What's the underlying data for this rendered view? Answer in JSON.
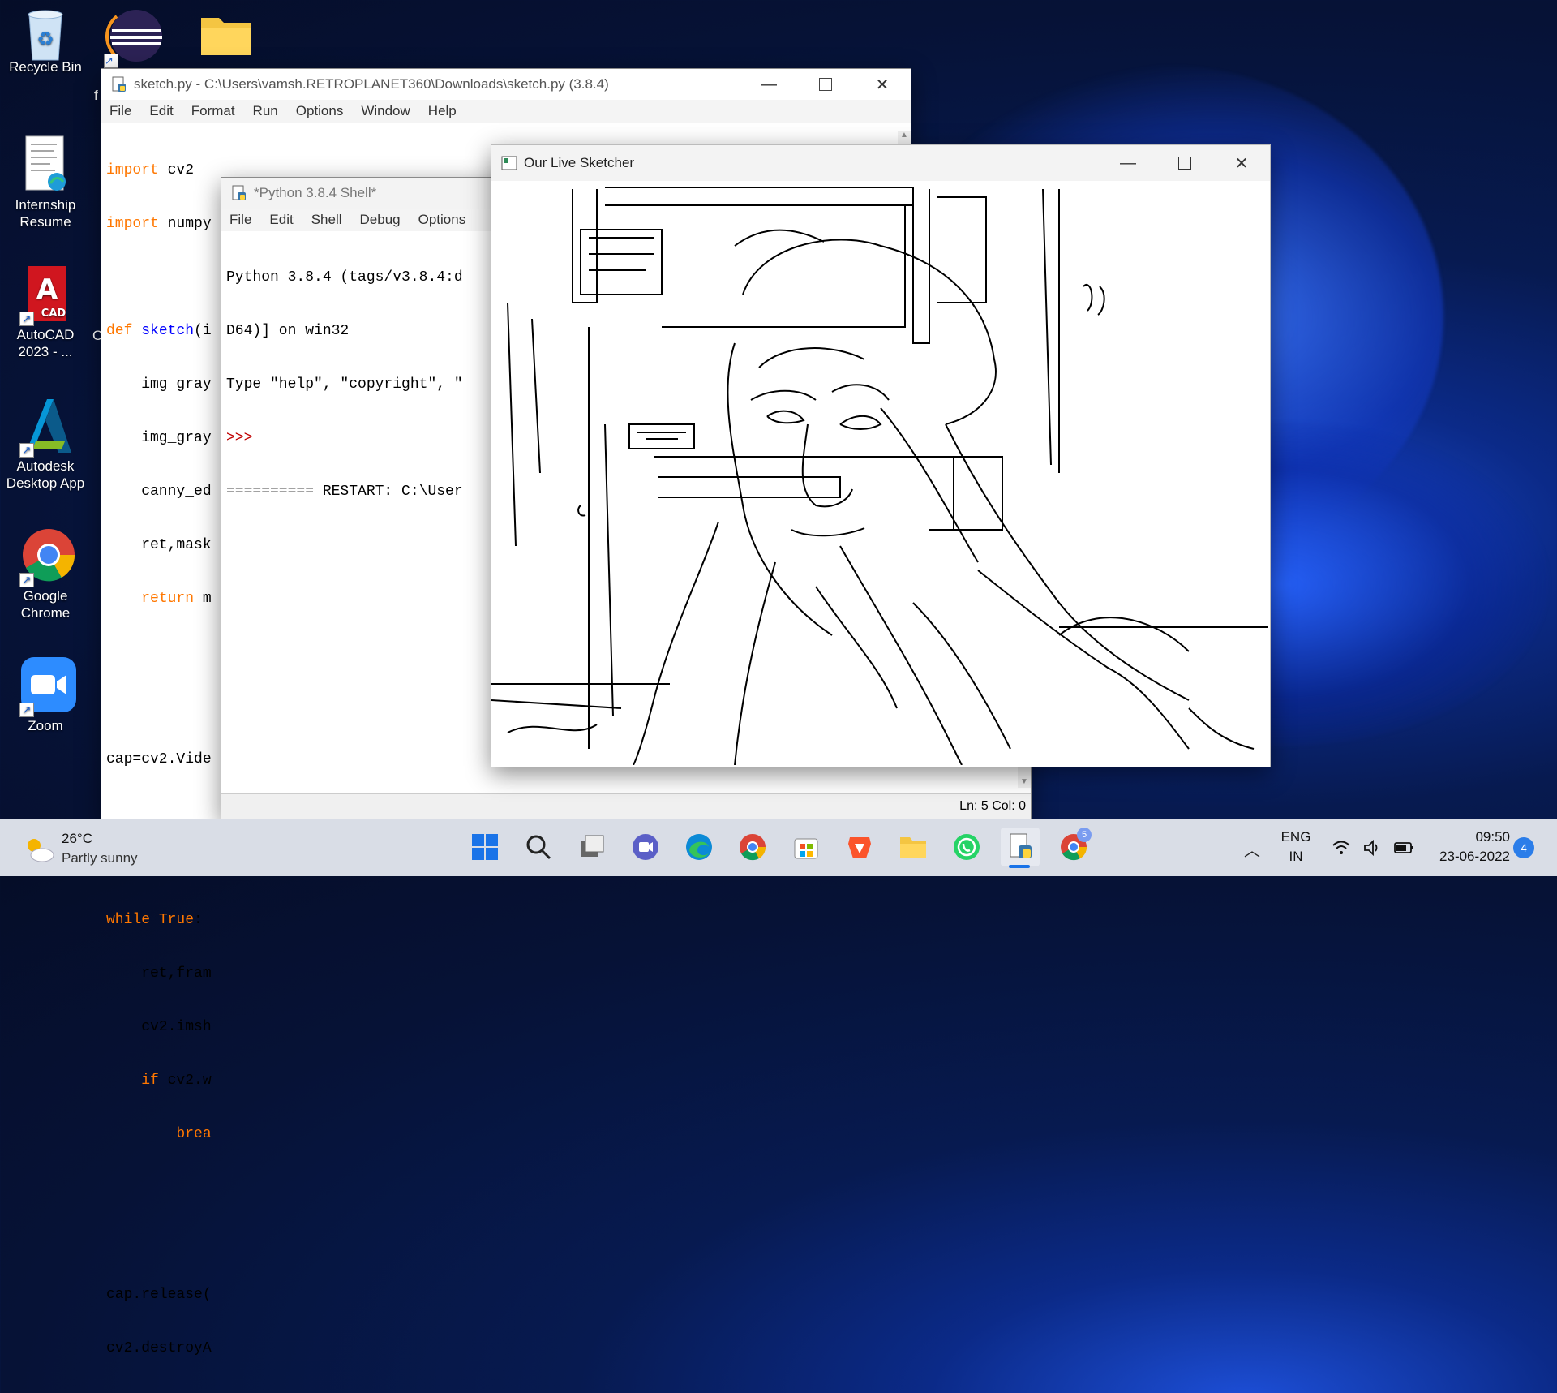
{
  "desktop": {
    "icons": [
      {
        "label": "Recycle Bin"
      },
      {
        "label": "Internship Resume"
      },
      {
        "label": "AutoCAD 2023 - ..."
      },
      {
        "label": "Autodesk Desktop App"
      },
      {
        "label": "Google Chrome"
      },
      {
        "label": "Zoom"
      }
    ],
    "partial_letter_1": "f",
    "partial_letter_2": "C"
  },
  "editor": {
    "title": "sketch.py - C:\\Users\\vamsh.RETROPLANET360\\Downloads\\sketch.py (3.8.4)",
    "menu": [
      "File",
      "Edit",
      "Format",
      "Run",
      "Options",
      "Window",
      "Help"
    ],
    "lines": [
      "import cv2",
      "import numpy as np",
      "",
      "def sketch(i",
      "    img_gray",
      "    img_gray",
      "    canny_ed",
      "    ret,mask",
      "    return m",
      "",
      "",
      "cap=cv2.Vide",
      "",
      "",
      "while True:",
      "    ret,fram",
      "    cv2.imsh",
      "    if cv2.w",
      "        brea",
      "",
      "",
      "cap.release(",
      "cv2.destroyA"
    ]
  },
  "shell": {
    "title": "*Python 3.8.4 Shell*",
    "menu": [
      "File",
      "Edit",
      "Shell",
      "Debug",
      "Options"
    ],
    "lines": [
      "Python 3.8.4 (tags/v3.8.4:d",
      "D64)] on win32",
      "Type \"help\", \"copyright\", \"",
      ">>>",
      "========== RESTART: C:\\User"
    ],
    "status": "Ln: 5  Col: 0"
  },
  "sketcher": {
    "title": "Our Live Sketcher"
  },
  "taskbar": {
    "weather_temp": "26°C",
    "weather_desc": "Partly sunny",
    "lang_1": "ENG",
    "lang_2": "IN",
    "time": "09:50",
    "date": "23-06-2022",
    "notification_count": "4",
    "chrome_badge": "5"
  }
}
